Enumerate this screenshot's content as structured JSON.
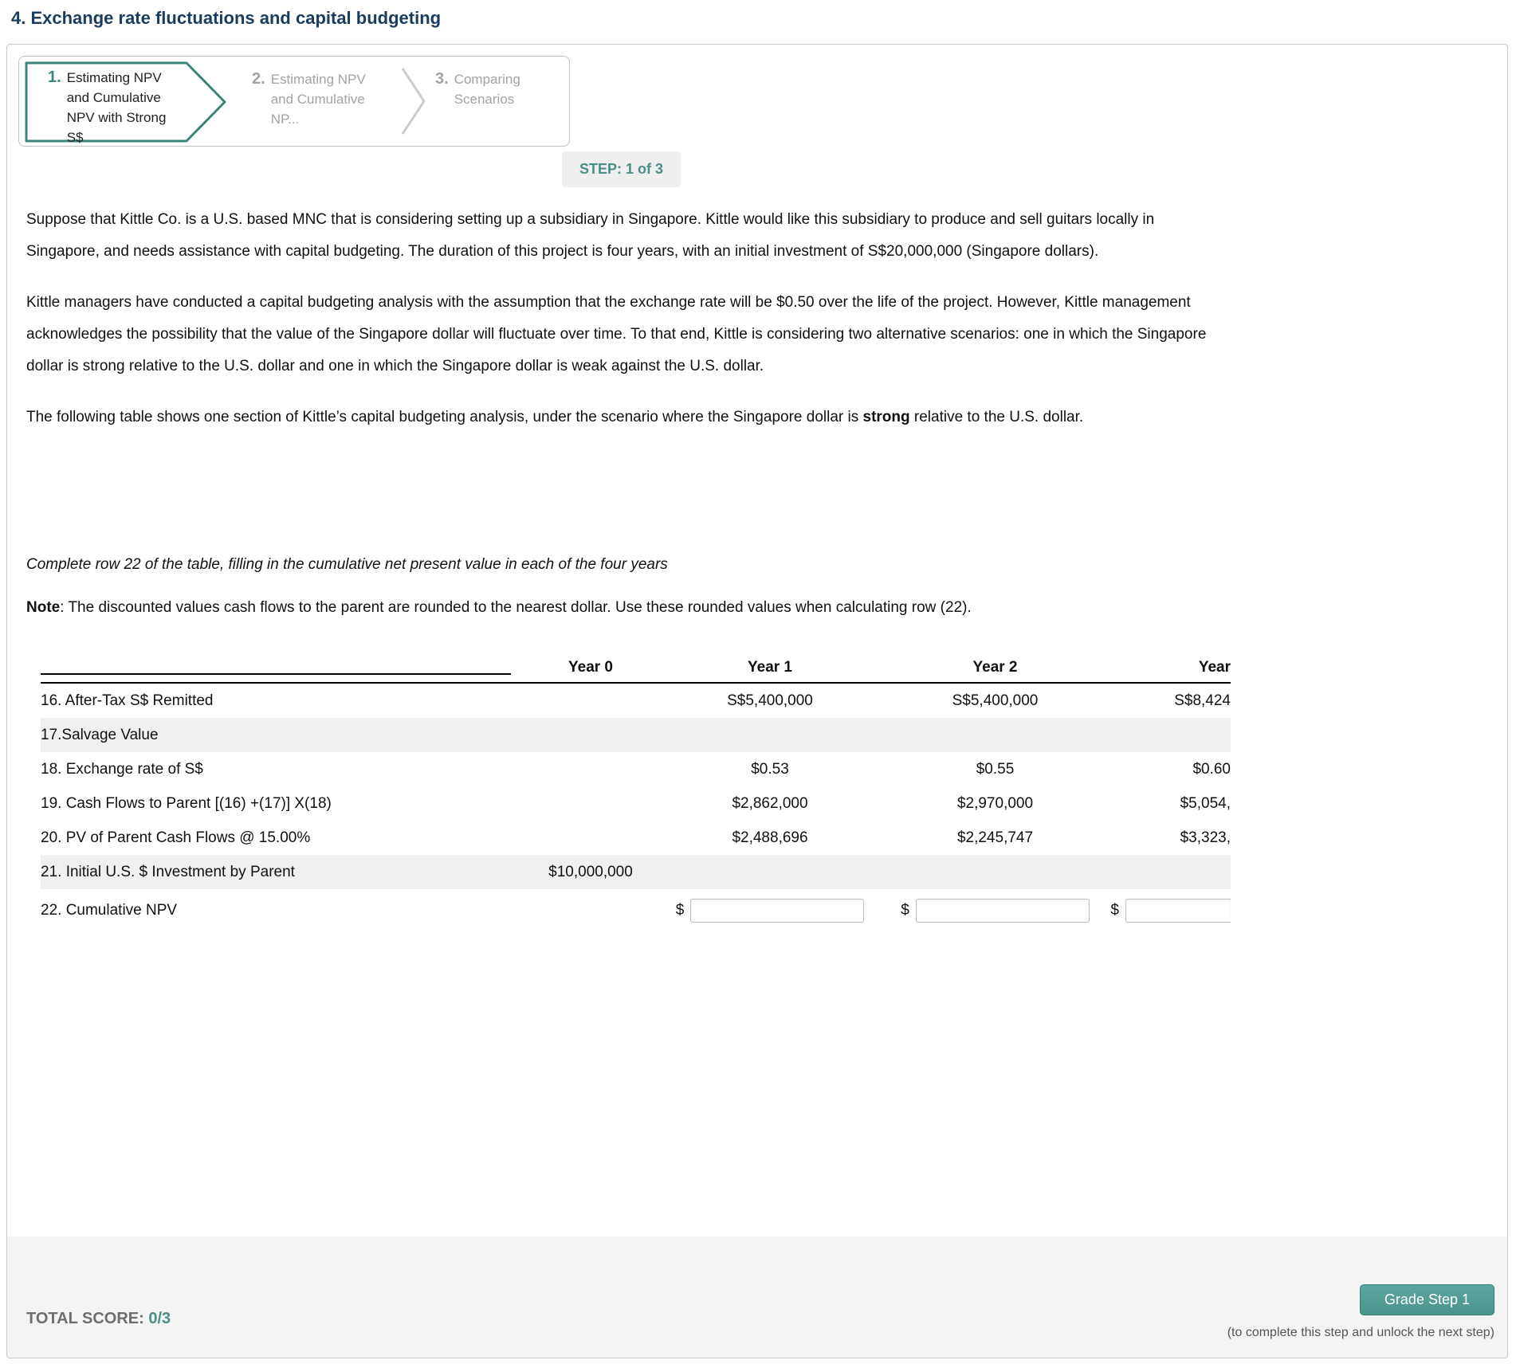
{
  "page": {
    "title": "4. Exchange rate fluctuations and capital budgeting"
  },
  "wizard": {
    "steps": [
      {
        "number": "1.",
        "label": "Estimating NPV and Cumulative NPV with Strong S$"
      },
      {
        "number": "2.",
        "label": "Estimating NPV and Cumulative NP..."
      },
      {
        "number": "3.",
        "label": "Comparing Scenarios"
      }
    ],
    "step_indicator": "STEP: 1 of 3"
  },
  "content": {
    "p1": "Suppose that Kittle Co. is a U.S. based MNC that is considering setting up a subsidiary in Singapore. Kittle would like this subsidiary to produce and sell guitars locally in Singapore, and needs assistance with capital budgeting. The duration of this project is four years, with an initial investment of S$20,000,000 (Singapore dollars).",
    "p2": "Kittle managers have conducted a capital budgeting analysis with the assumption that the exchange rate will be $0.50 over the life of the project. However, Kittle management acknowledges the possibility that the value of the Singapore dollar will fluctuate over time. To that end, Kittle is considering two alternative scenarios: one in which the Singapore dollar is strong relative to the U.S. dollar and one in which the Singapore dollar is weak against the U.S. dollar.",
    "p3_before": "The following table shows one section of Kittle’s capital budgeting analysis, under the scenario where the Singapore dollar is ",
    "p3_bold": "strong",
    "p3_after": " relative to the U.S. dollar.",
    "instruction": "Complete row 22 of the table, filling in the cumulative net present value in each of the four years",
    "note_label": "Note",
    "note_text": ": The discounted values cash flows to the parent are rounded to the nearest dollar. Use these rounded values when calculating row (22)."
  },
  "table": {
    "headers": [
      "",
      "Year 0",
      "Year 1",
      "Year 2",
      "Year"
    ],
    "rows": [
      {
        "label": "16. After-Tax S$ Remitted",
        "y0": "",
        "y1": "S$5,400,000",
        "y2": "S$5,400,000",
        "y3": "S$8,424"
      },
      {
        "label": "17.Salvage Value",
        "y0": "",
        "y1": "",
        "y2": "",
        "y3": ""
      },
      {
        "label": "18. Exchange rate of S$",
        "y0": "",
        "y1": "$0.53",
        "y2": "$0.55",
        "y3": "$0.60"
      },
      {
        "label": "19. Cash Flows to Parent [(16) +(17)] X(18)",
        "y0": "",
        "y1": "$2,862,000",
        "y2": "$2,970,000",
        "y3": "$5,054,"
      },
      {
        "label": "20. PV of Parent Cash Flows @ 15.00%",
        "y0": "",
        "y1": "$2,488,696",
        "y2": "$2,245,747",
        "y3": "$3,323,"
      },
      {
        "label": "21. Initial U.S. $ Investment by Parent",
        "y0": "$10,000,000",
        "y1": "",
        "y2": "",
        "y3": ""
      }
    ],
    "input_row": {
      "label": "22. Cumulative NPV",
      "currency": "$"
    }
  },
  "footer": {
    "total_score_label": "TOTAL SCORE: ",
    "total_score_value": "0/3",
    "grade_button_label": "Grade Step 1",
    "unlock_note": "(to complete this step and unlock the next step)"
  },
  "colors": {
    "accent_teal": "#4a948c",
    "title_blue": "#1b3c5f",
    "inactive_gray": "#a3a3a3",
    "shaded_row": "#f0f0f0"
  }
}
